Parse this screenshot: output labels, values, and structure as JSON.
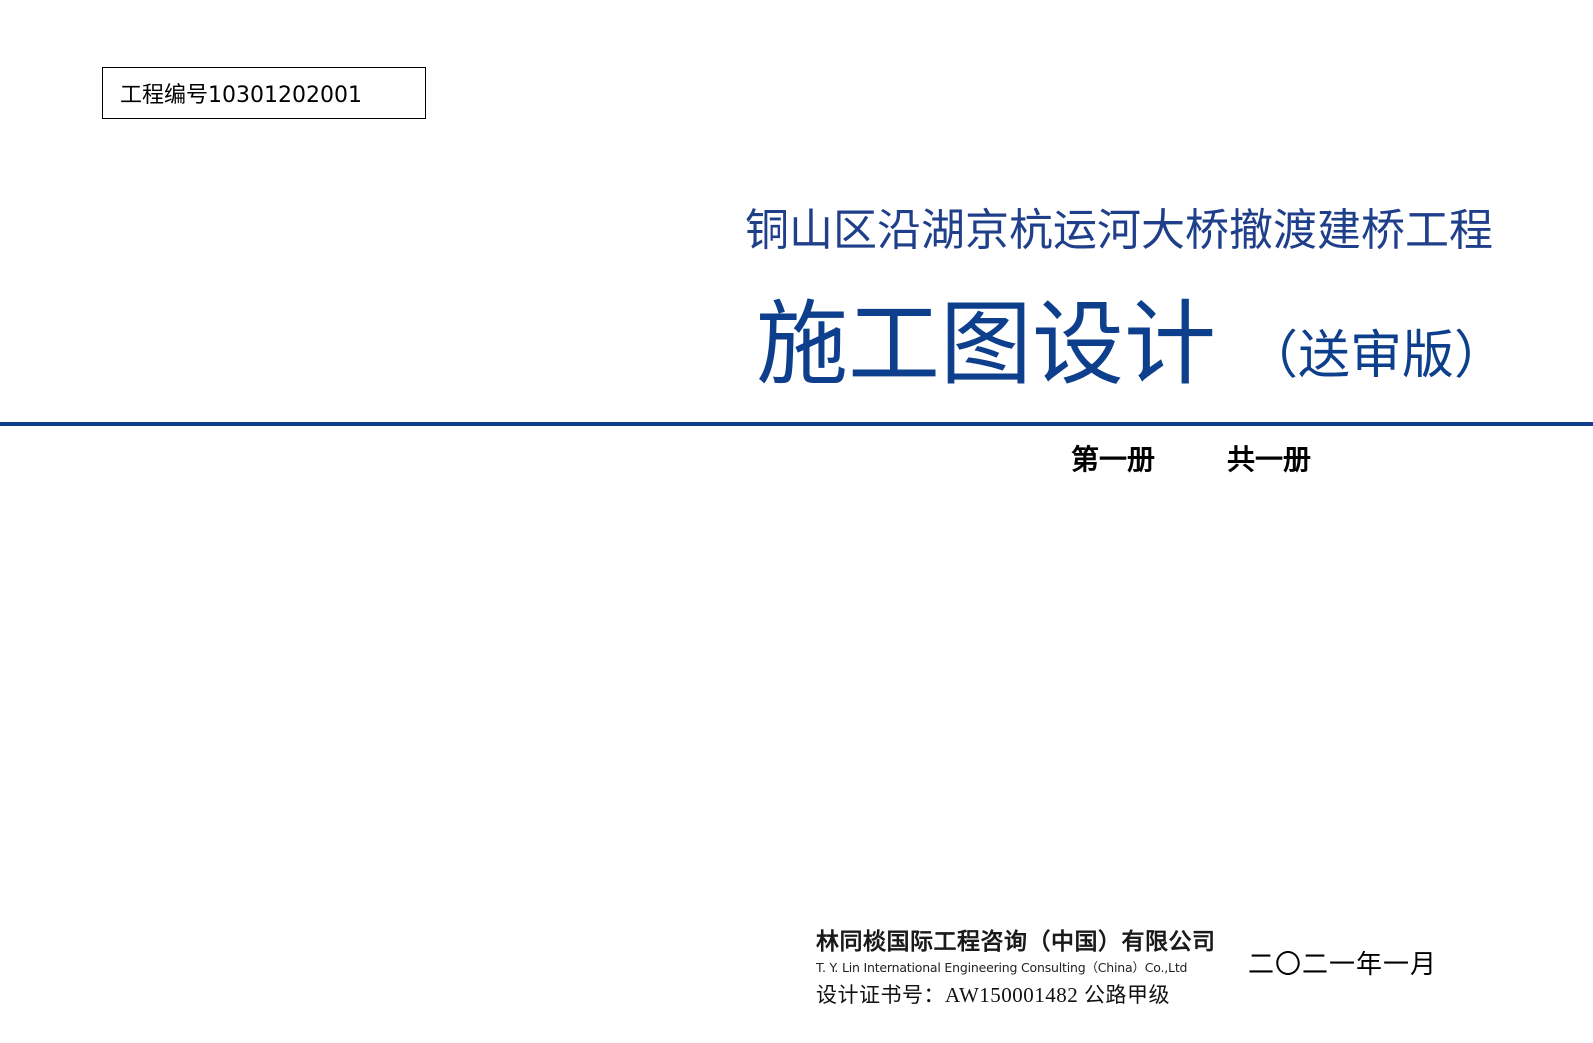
{
  "project_number": {
    "text": "工程编号10301202001"
  },
  "title": {
    "project_name": "铜山区沿湖京杭运河大桥撤渡建桥工程",
    "design_stage": "施工图设计",
    "review_suffix": "（送审版）"
  },
  "volume": {
    "current": "第一册",
    "total": "共一册"
  },
  "company": {
    "name_cn": "林同棪国际工程咨询（中国）有限公司",
    "name_en": "T. Y. Lin International Engineering Consulting（China）Co.,Ltd",
    "certificate": "设计证书号：AW150001482 公路甲级"
  },
  "date": {
    "text": "二〇二一年一月"
  },
  "colors": {
    "accent_blue": "#0e3f8c",
    "project_title_blue": "#1f3f8a",
    "text": "#000000"
  }
}
